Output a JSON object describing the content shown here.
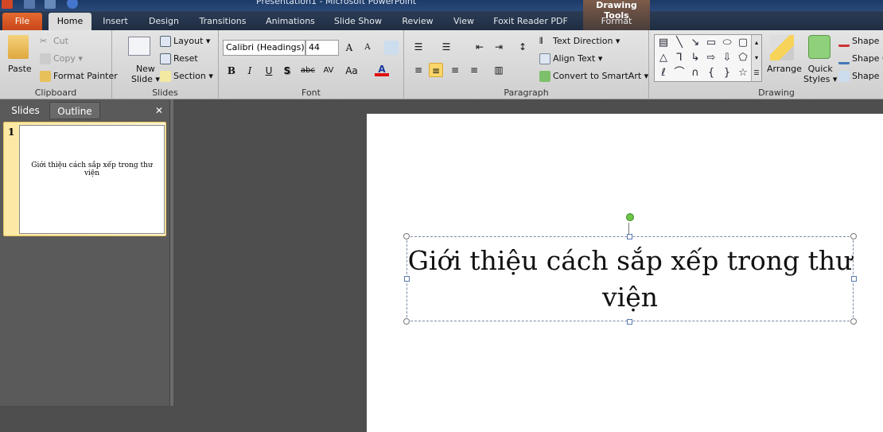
{
  "window": {
    "title": "Presentation1  -  Microsoft PowerPoint"
  },
  "tabs": [
    {
      "label": "File"
    },
    {
      "label": "Home"
    },
    {
      "label": "Insert"
    },
    {
      "label": "Design"
    },
    {
      "label": "Transitions"
    },
    {
      "label": "Animations"
    },
    {
      "label": "Slide Show"
    },
    {
      "label": "Review"
    },
    {
      "label": "View"
    },
    {
      "label": "Foxit Reader PDF"
    }
  ],
  "contextual": {
    "header": "Drawing Tools",
    "tab": "Format"
  },
  "clipboard": {
    "label": "Clipboard",
    "paste": "Paste",
    "cut": "Cut",
    "copy": "Copy",
    "format_painter": "Format Painter"
  },
  "slides_group": {
    "label": "Slides",
    "new_slide_1": "New",
    "new_slide_2": "Slide",
    "layout": "Layout",
    "reset": "Reset",
    "section": "Section"
  },
  "font": {
    "label": "Font",
    "family": "Calibri (Headings)",
    "size": "44",
    "bold": "B",
    "italic": "I",
    "underline": "U",
    "shadow": "S",
    "strike": "abc",
    "spacing": "AV",
    "case": "Aa",
    "color_a": "A",
    "font_color": "#e01010"
  },
  "paragraph": {
    "label": "Paragraph",
    "text_direction": "Text Direction",
    "align_text": "Align Text",
    "smartart": "Convert to SmartArt"
  },
  "drawing": {
    "label": "Drawing",
    "arrange": "Arrange",
    "quick_styles_1": "Quick",
    "quick_styles_2": "Styles",
    "shape_fill": "Shape Fill",
    "shape_outline": "Shape Outline",
    "shape_effects": "Shape Effects"
  },
  "panel": {
    "tab_slides": "Slides",
    "tab_outline": "Outline",
    "close": "✕",
    "slide_number": "1",
    "thumb_text": "Giới thiệu cách sắp xếp trong thư viện"
  },
  "slide": {
    "title_text": "Giới thiệu cách sắp xếp trong thư viện"
  }
}
